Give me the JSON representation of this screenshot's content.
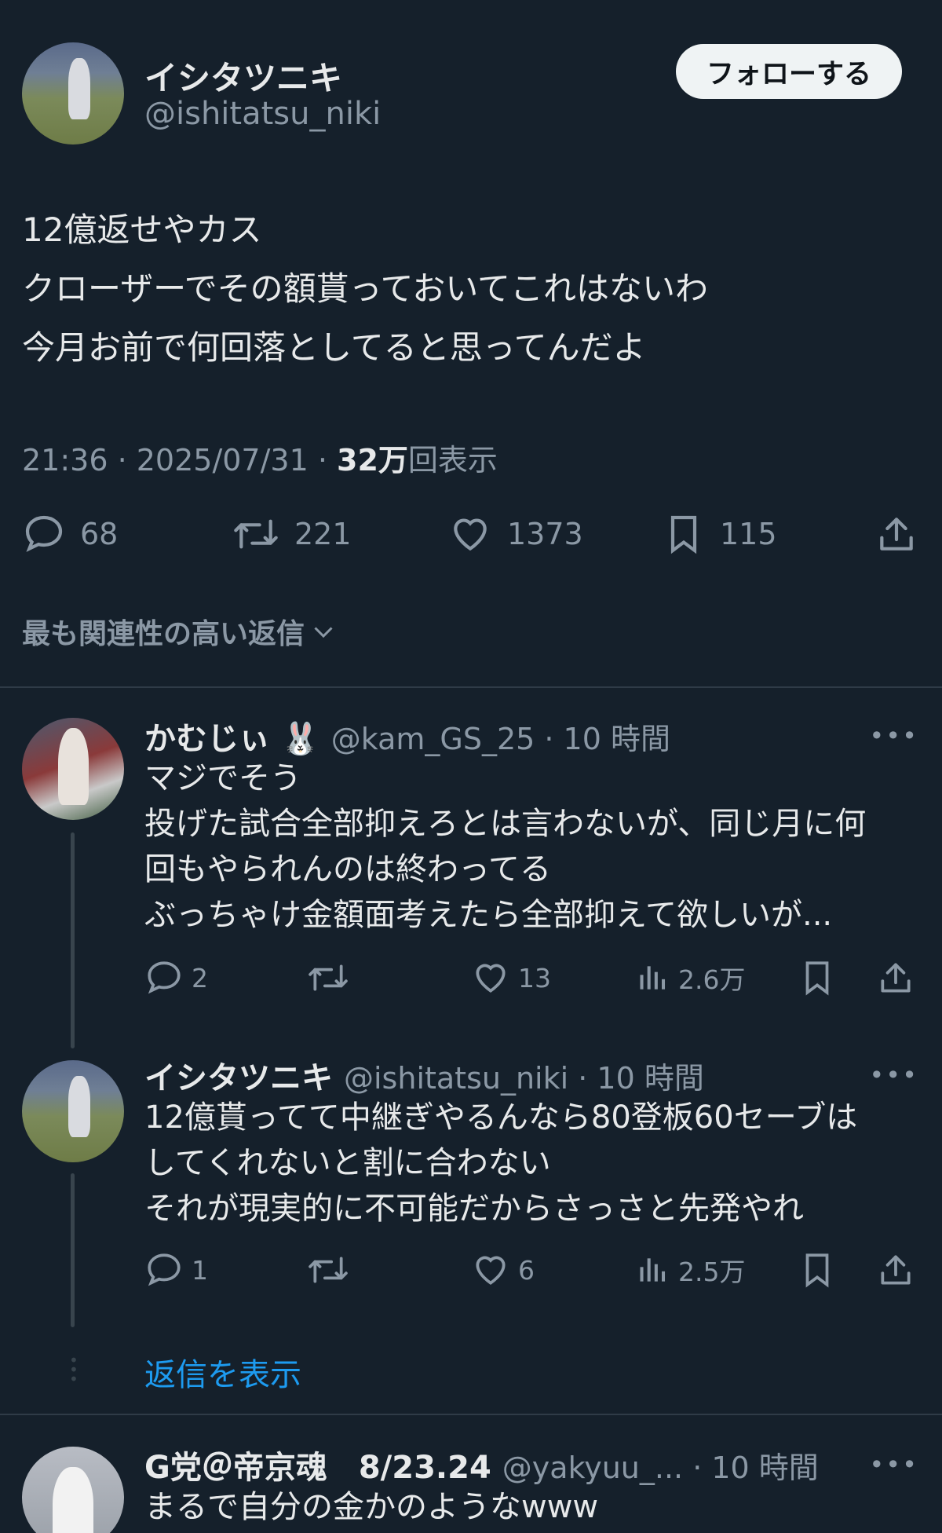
{
  "tweet": {
    "author_name": "イシタツニキ",
    "author_handle": "@ishitatsu_niki",
    "follow_label": "フォローする",
    "lines": [
      "12億返せやカス",
      "クローザーでその額貰っておいてこれはないわ",
      "今月お前で何回落としてると思ってんだよ"
    ],
    "time": "21:36 · 2025/07/31 · ",
    "views_num": "32万",
    "views_suffix": "回表示",
    "actions": {
      "reply_count": "68",
      "retweet_count": "221",
      "like_count": "1373",
      "bookmark_count": "115"
    }
  },
  "sort": {
    "label": "最も関連性の高い返信"
  },
  "replies": [
    {
      "name": "かむじぃ 🐰",
      "handle": "@kam_GS_25 · 10 時間",
      "lines": [
        "マジでそう",
        "投げた試合全部抑えろとは言わないが、同じ月に何",
        "回もやられんのは終わってる",
        "ぶっちゃけ金額面考えたら全部抑えて欲しいが..."
      ],
      "reply_count": "2",
      "retweet_count": "",
      "like_count": "13",
      "views": "2.6万"
    },
    {
      "name": "イシタツニキ",
      "handle": "@ishitatsu_niki · 10 時間",
      "lines": [
        "12億貰ってて中継ぎやるんなら80登板60セーブは",
        "してくれないと割に合わない",
        "それが現実的に不可能だからさっさと先発やれ"
      ],
      "reply_count": "1",
      "retweet_count": "",
      "like_count": "6",
      "views": "2.5万"
    }
  ],
  "show_replies_label": "返信を表示",
  "third": {
    "name": "G党＠帝京魂　8/23.24",
    "handle": "@yakyuu_... · 10 時間",
    "line": "まるで自分の金かのようなwww"
  },
  "more_label": "•••",
  "colors": {
    "background": "#15202b",
    "accent": "#1d9bf0",
    "muted": "#8b98a5"
  }
}
